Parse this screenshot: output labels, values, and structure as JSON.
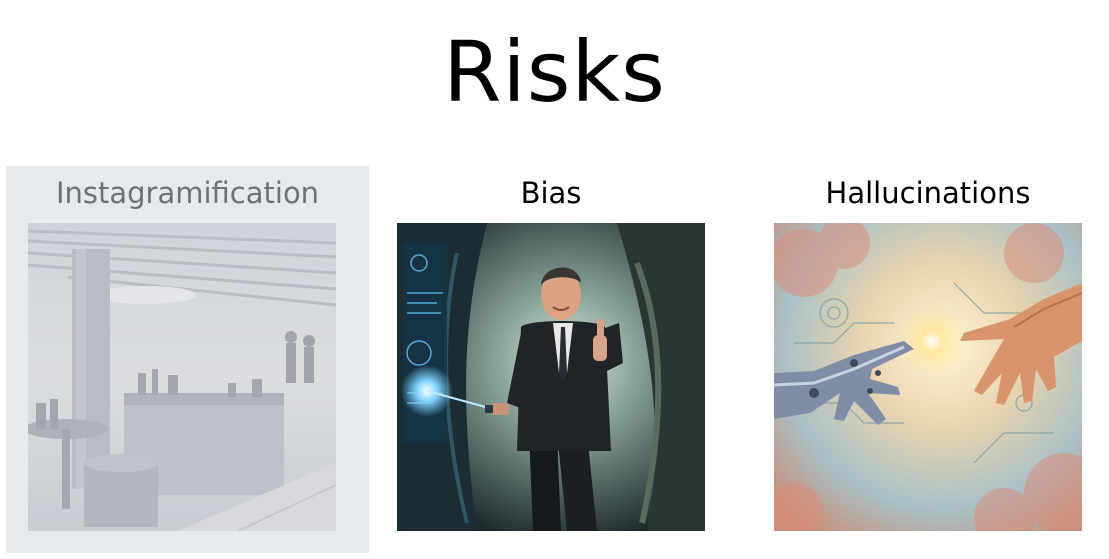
{
  "slide": {
    "title": "Risks",
    "columns": [
      {
        "label": "Instagramification",
        "image": "cafe-interior-photo",
        "state": "dimmed"
      },
      {
        "label": "Bias",
        "image": "businessman-cave-thumbs-up-photo",
        "state": "normal"
      },
      {
        "label": "Hallucinations",
        "image": "robot-human-hands-touching-illustration",
        "state": "normal"
      }
    ]
  },
  "colors": {
    "background": "#ffffff",
    "dimmed_panel": "#e6e9ee",
    "dimmed_text": "#6e7278",
    "text": "#000000"
  }
}
